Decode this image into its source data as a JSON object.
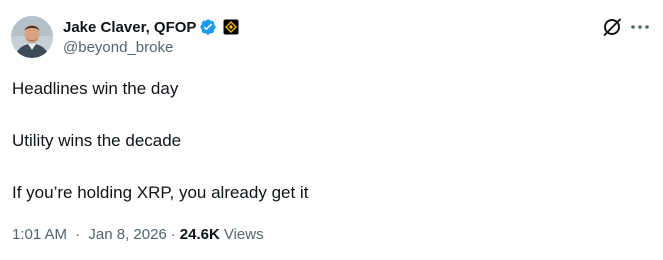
{
  "author": {
    "display_name": "Jake Claver, QFOP",
    "handle": "@beyond_broke",
    "verified": true,
    "verified_color": "#1d9bf0",
    "affiliate_badge_color": "#f0b90b",
    "avatar_icon": "profile-photo"
  },
  "actions": {
    "grok_icon": "grok-icon",
    "more_icon": "more-options-icon"
  },
  "content": {
    "lines": [
      "Headlines win the day",
      "Utility wins the decade",
      "If you’re holding XRP, you already get it"
    ]
  },
  "meta": {
    "time": "1:01 AM",
    "separator": "·",
    "date": "Jan 8, 2026",
    "views_count": "24.6K",
    "views_label": "Views"
  }
}
